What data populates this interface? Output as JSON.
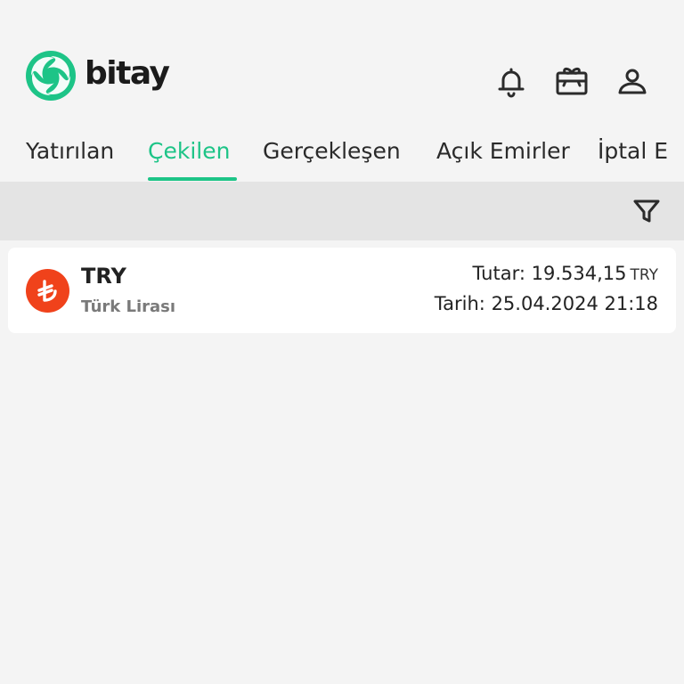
{
  "header": {
    "brand_name": "bitay",
    "brand_color": "#1dc487",
    "icons": [
      "bell-icon",
      "gift-card-icon",
      "user-icon"
    ]
  },
  "tabs": [
    {
      "label": "Yatırılan",
      "active": false
    },
    {
      "label": "Çekilen",
      "active": true
    },
    {
      "label": "Gerçekleşen",
      "active": false
    },
    {
      "label": "Açık Emirler",
      "active": false
    },
    {
      "label": "İptal E",
      "active": false
    }
  ],
  "filter": {
    "icon": "filter-icon"
  },
  "transactions": [
    {
      "symbol": "TRY",
      "name": "Türk Lirası",
      "icon_color": "#f0421b",
      "amount_label": "Tutar:",
      "amount_value": "19.534,15",
      "amount_unit": "TRY",
      "date_label": "Tarih:",
      "date_value": "25.04.2024 21:18"
    }
  ]
}
